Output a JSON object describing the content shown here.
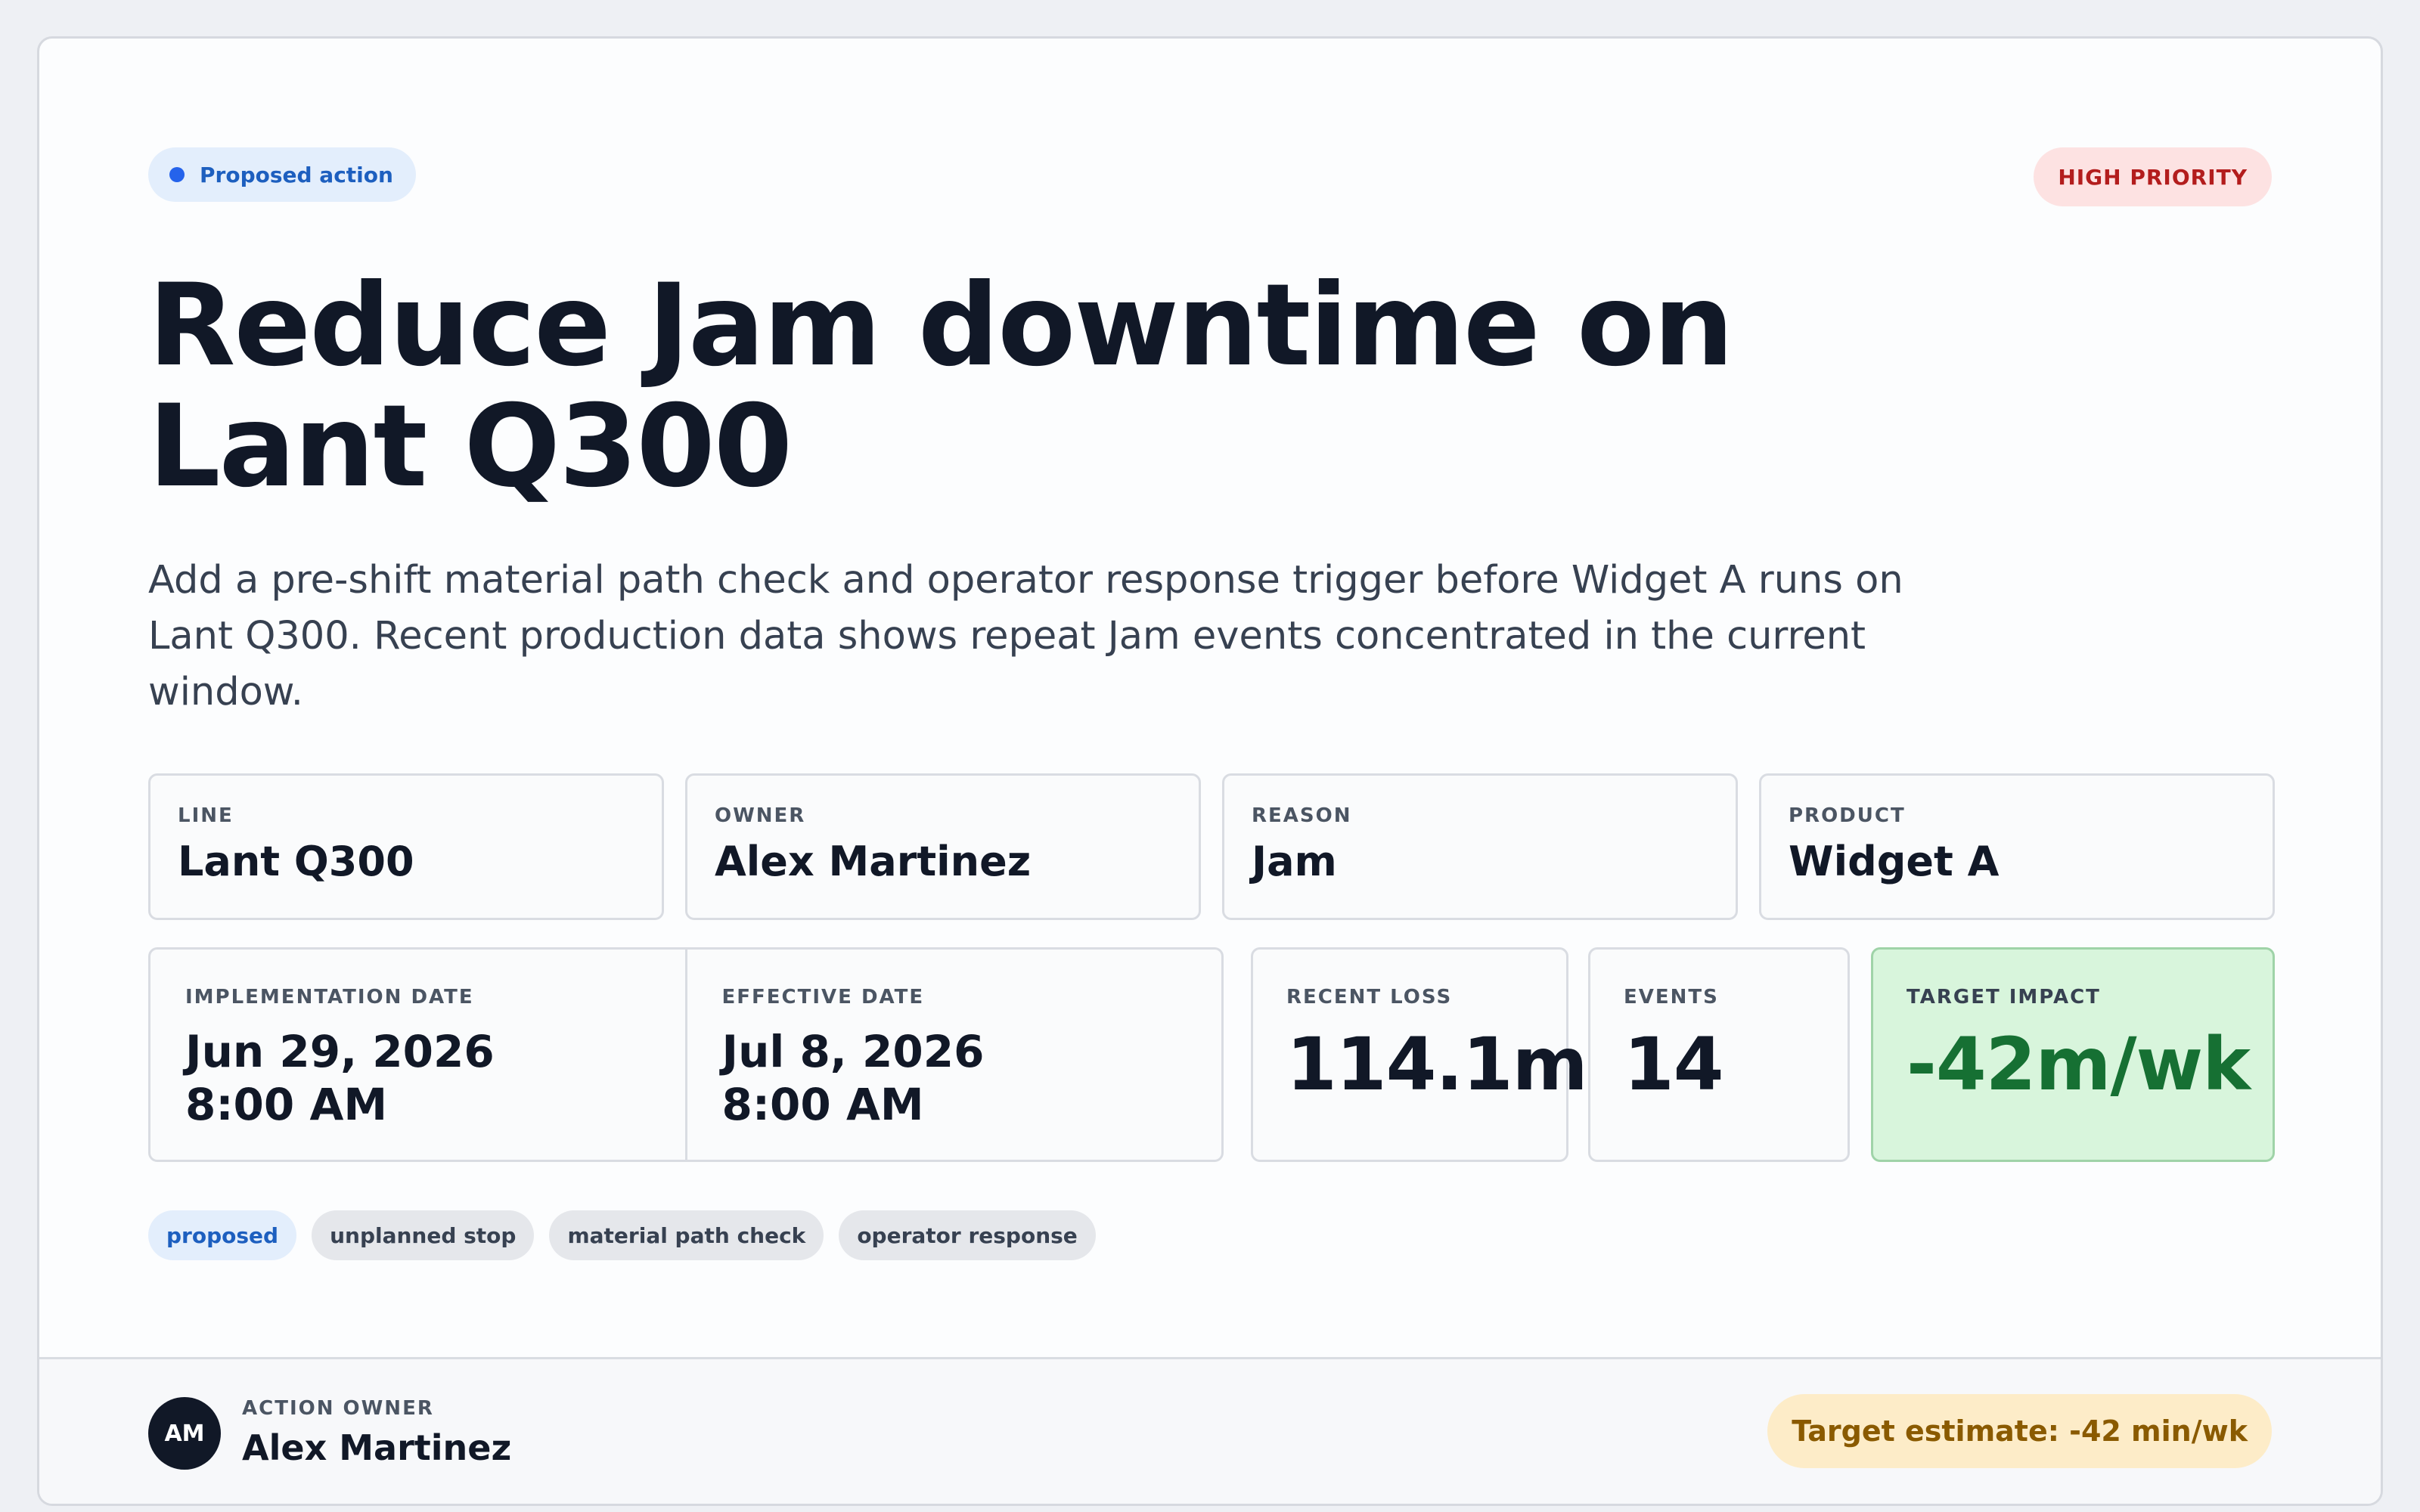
{
  "badge": {
    "status": "Proposed action",
    "priority": "HIGH PRIORITY"
  },
  "title": "Reduce Jam downtime on Lant Q300",
  "description": "Add a pre-shift material path check and operator response trigger before Widget A runs on Lant Q300. Recent production data shows repeat Jam events concentrated in the current window.",
  "info": [
    {
      "label": "LINE",
      "value": "Lant Q300"
    },
    {
      "label": "OWNER",
      "value": "Alex Martinez"
    },
    {
      "label": "REASON",
      "value": "Jam"
    },
    {
      "label": "PRODUCT",
      "value": "Widget A"
    }
  ],
  "dates": {
    "implementation": {
      "label": "IMPLEMENTATION DATE",
      "date": "Jun 29, 2026",
      "time": "8:00 AM"
    },
    "effective": {
      "label": "EFFECTIVE DATE",
      "date": "Jul 8, 2026",
      "time": "8:00 AM"
    }
  },
  "metrics": {
    "recent_loss": {
      "label": "RECENT LOSS",
      "value": "114.1m"
    },
    "events": {
      "label": "EVENTS",
      "value": "14"
    },
    "target_impact": {
      "label": "TARGET IMPACT",
      "value": "-42m/wk"
    }
  },
  "tags": [
    "proposed",
    "unplanned stop",
    "material path check",
    "operator response"
  ],
  "footer": {
    "avatar_initials": "AM",
    "owner_label": "ACTION OWNER",
    "owner_name": "Alex Martinez",
    "estimate": "Target estimate: -42 min/wk"
  },
  "colors": {
    "accent_blue": "#2563eb",
    "priority_red": "#b31d1d",
    "impact_green": "#167033",
    "estimate_amber": "#8a5a00"
  }
}
